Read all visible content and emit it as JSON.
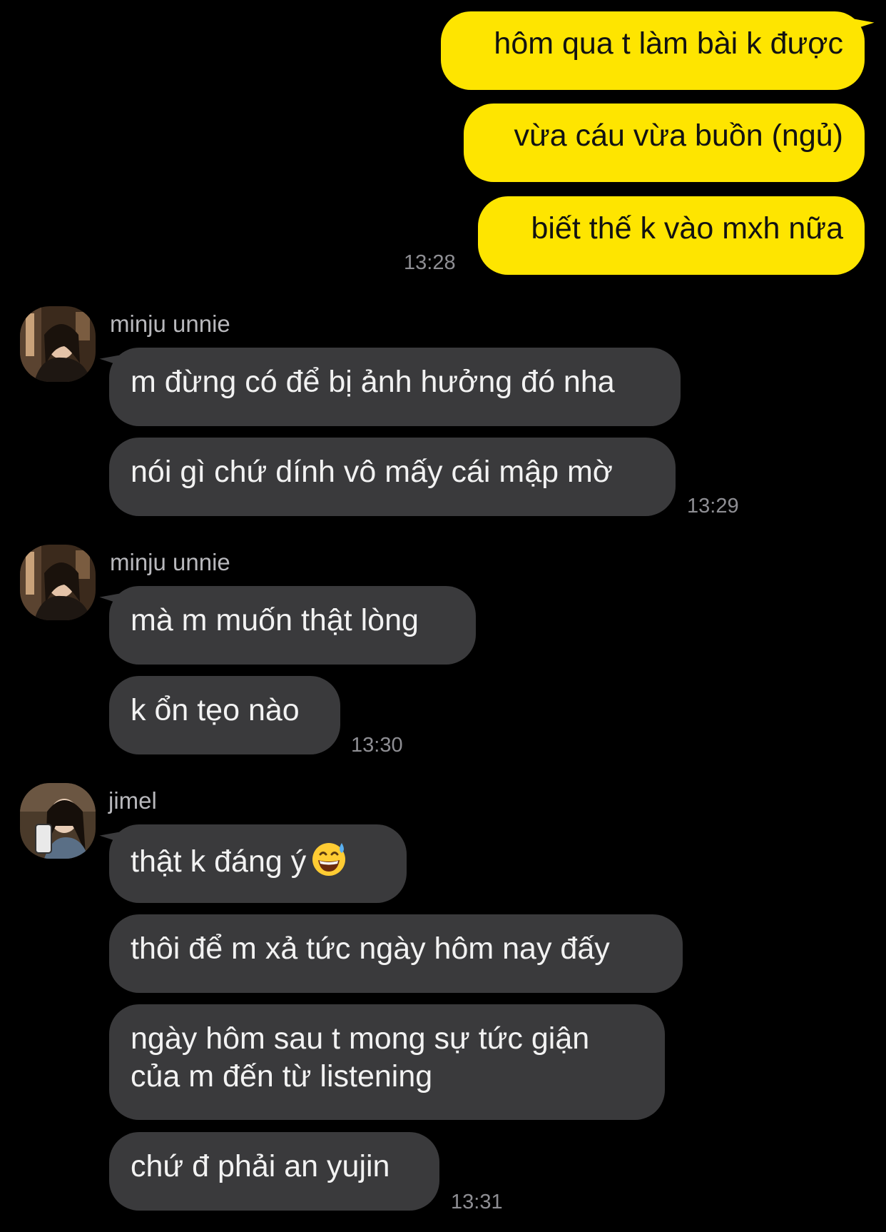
{
  "outgoing_group": {
    "messages": [
      "hôm qua t làm bài k được",
      "vừa cáu vừa buồn (ngủ)",
      "biết thế k vào mxh nữa"
    ],
    "time": "13:28"
  },
  "incoming_groups": [
    {
      "sender": "minju unnie",
      "avatar_icon": "avatar-minju-icon",
      "messages": [
        "m đừng có để bị ảnh hưởng đó nha",
        "nói gì chứ dính vô mấy cái mập mờ"
      ],
      "time": "13:29"
    },
    {
      "sender": "minju unnie",
      "avatar_icon": "avatar-minju-icon",
      "messages": [
        "mà m muốn thật lòng",
        "k ổn tẹo nào"
      ],
      "time": "13:30"
    },
    {
      "sender": "jimel",
      "avatar_icon": "avatar-jimel-icon",
      "messages": [
        "thật k đáng ý",
        "thôi để m xả tức ngày hôm nay đấy",
        "ngày hôm sau t mong sự tức giận",
        "của m đến từ listening",
        "chứ đ phải an yujin"
      ],
      "emoji_icon": "grinning-sweat-emoji-icon",
      "time": "13:31"
    }
  ],
  "colors": {
    "background": "#000000",
    "outgoing_bubble": "#fee500",
    "incoming_bubble": "#3a3a3c",
    "timestamp": "#8e8e93"
  }
}
